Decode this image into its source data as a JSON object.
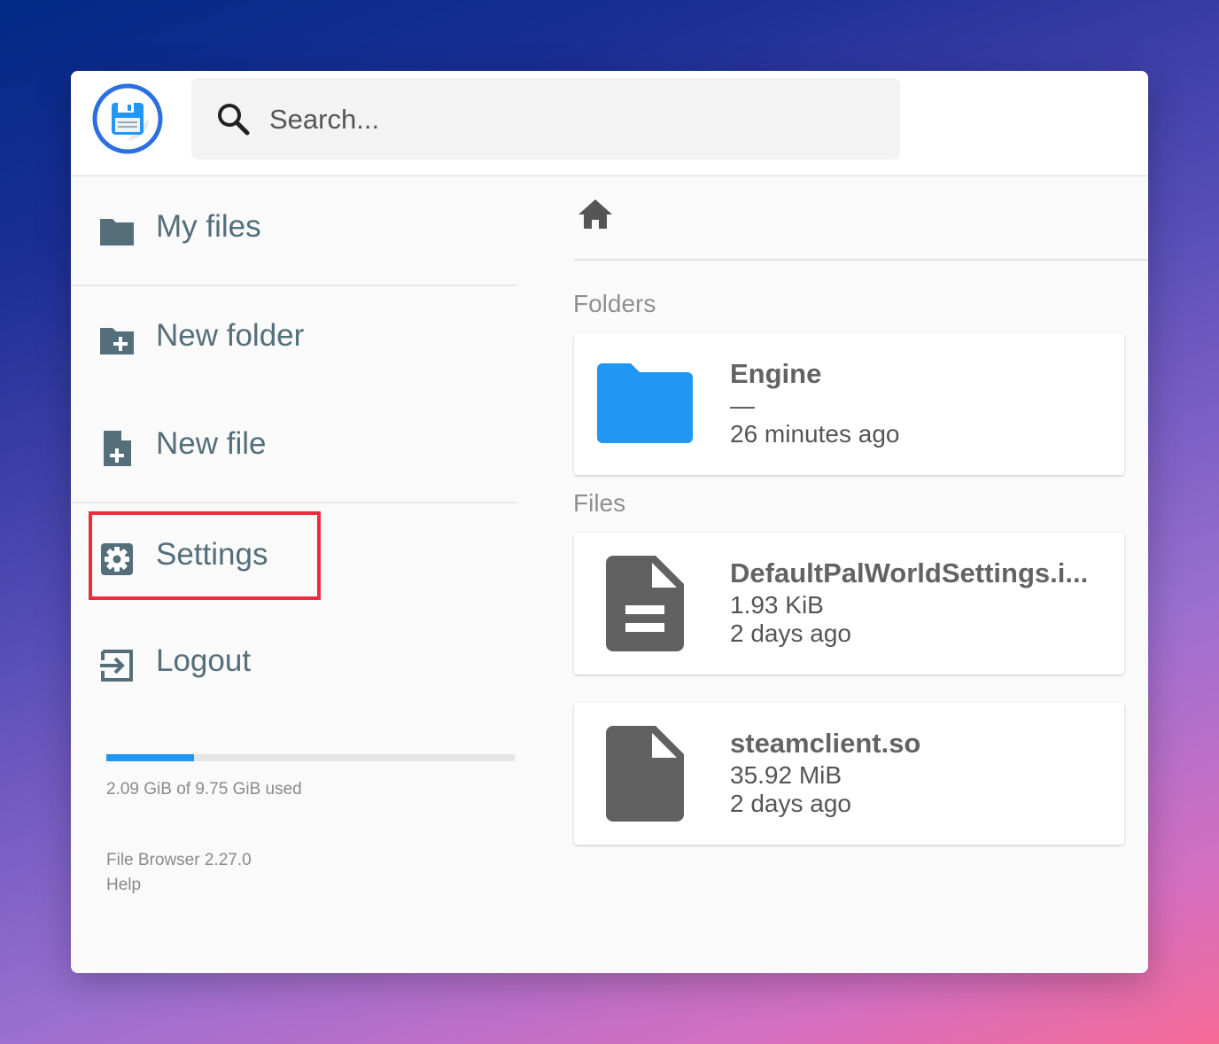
{
  "app": {
    "logo_icon": "floppy-disk-logo-icon",
    "accent_color": "#2196f3"
  },
  "search": {
    "placeholder": "Search...",
    "icon": "search-icon"
  },
  "sidebar": {
    "items": [
      {
        "label": "My files",
        "icon": "folder-icon"
      },
      {
        "label": "New folder",
        "icon": "folder-plus-icon"
      },
      {
        "label": "New file",
        "icon": "file-plus-icon"
      },
      {
        "label": "Settings",
        "icon": "gear-icon",
        "highlighted": true
      },
      {
        "label": "Logout",
        "icon": "logout-icon"
      }
    ],
    "usage": {
      "text": "2.09 GiB of 9.75 GiB used",
      "fraction": 0.214
    },
    "version": "File Browser 2.27.0",
    "help": "Help",
    "highlight_color": "#ef2b40"
  },
  "main": {
    "breadcrumb_icon": "home-icon",
    "folders_title": "Folders",
    "files_title": "Files",
    "folders": [
      {
        "name": "Engine",
        "size": "—",
        "modified": "26 minutes ago",
        "icon": "folder-icon",
        "color": "#2196f3"
      }
    ],
    "files": [
      {
        "name": "DefaultPalWorldSettings.i...",
        "size": "1.93 KiB",
        "modified": "2 days ago",
        "icon": "document-icon"
      },
      {
        "name": "steamclient.so",
        "size": "35.92 MiB",
        "modified": "2 days ago",
        "icon": "file-icon"
      }
    ]
  }
}
